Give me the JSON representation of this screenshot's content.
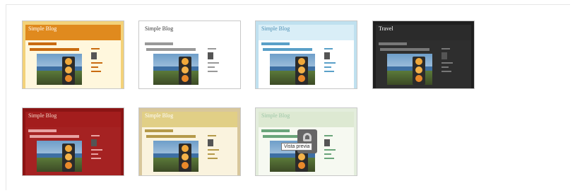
{
  "templates": [
    {
      "title": "Simple Blog",
      "bg": "#f3d27a",
      "header": "#e08a1e",
      "title_color": "#ffffff",
      "body": "#fff7dd",
      "accent": "#c96b10"
    },
    {
      "title": "Simple Blog",
      "bg": "#ffffff",
      "header": "#ffffff",
      "title_color": "#333333",
      "body": "#ffffff",
      "accent": "#999999"
    },
    {
      "title": "Simple Blog",
      "bg": "#bfe0ef",
      "header": "#d9eef7",
      "title_color": "#4b8fb4",
      "body": "#ffffff",
      "accent": "#5aa0c8"
    },
    {
      "title": "Travel",
      "bg": "#1f1f1f",
      "header": "#2b2b2b",
      "title_color": "#ffffff",
      "body": "#2e2e2e",
      "accent": "#777777"
    },
    {
      "title": "Simple Blog",
      "bg": "#8b1414",
      "header": "#a31d1d",
      "title_color": "#f3d7c7",
      "body": "#a52222",
      "accent": "#e8a2a2"
    },
    {
      "title": "Simple Blog",
      "bg": "#d8c79c",
      "header": "#e1cf86",
      "title_color": "#ffffff",
      "body": "#faf3de",
      "accent": "#b59a4a"
    },
    {
      "title": "Simple Blog",
      "bg": "#e3eddc",
      "header": "#dde9d2",
      "title_color": "#9cc6a6",
      "body": "#f6f9f1",
      "accent": "#6aa57a"
    }
  ],
  "tooltip": "Vista previa"
}
